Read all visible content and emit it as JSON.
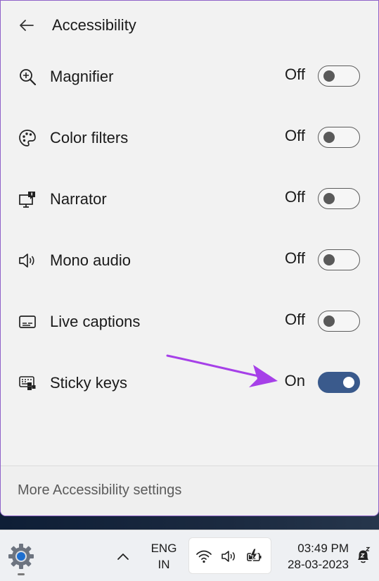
{
  "panel": {
    "title": "Accessibility",
    "items": [
      {
        "icon": "magnifier-icon",
        "label": "Magnifier",
        "state": "Off",
        "on": false
      },
      {
        "icon": "color-filters-icon",
        "label": "Color filters",
        "state": "Off",
        "on": false
      },
      {
        "icon": "narrator-icon",
        "label": "Narrator",
        "state": "Off",
        "on": false
      },
      {
        "icon": "mono-audio-icon",
        "label": "Mono audio",
        "state": "Off",
        "on": false
      },
      {
        "icon": "live-captions-icon",
        "label": "Live captions",
        "state": "Off",
        "on": false
      },
      {
        "icon": "sticky-keys-icon",
        "label": "Sticky keys",
        "state": "On",
        "on": true
      }
    ],
    "footer_link": "More Accessibility settings"
  },
  "taskbar": {
    "lang_line1": "ENG",
    "lang_line2": "IN",
    "time": "03:49 PM",
    "date": "28-03-2023"
  },
  "colors": {
    "toggle_on": "#3a5a8c",
    "annotation_arrow": "#a640e8",
    "flyout_border": "#8f63c9"
  }
}
